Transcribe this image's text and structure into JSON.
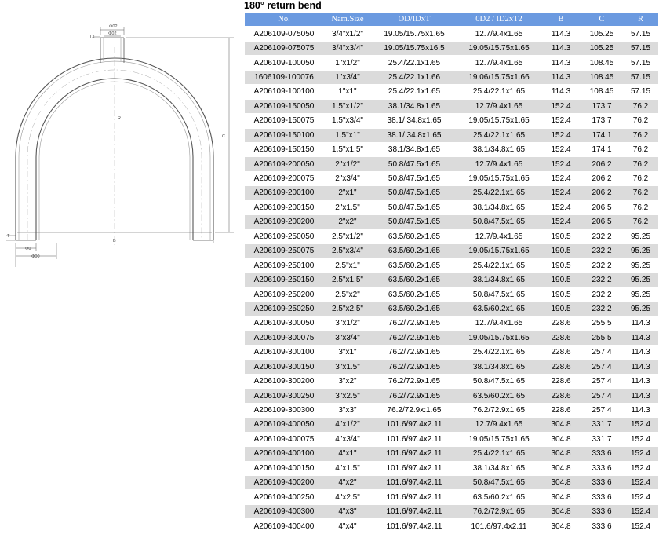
{
  "title": "180° return bend",
  "drawing": {
    "labels": [
      "Φ02",
      "Φ02",
      "T2",
      "C",
      "R",
      "B",
      "T",
      "Φ0",
      "Φ00"
    ]
  },
  "table": {
    "headers": [
      "No.",
      "Nam.Size",
      "OD/IDxT",
      "0D2 / ID2xT2",
      "B",
      "C",
      "R"
    ],
    "rows": [
      [
        "A206109-075050",
        "3/4\"x1/2\"",
        "19.05/15.75x1.65",
        "12.7/9.4x1.65",
        "114.3",
        "105.25",
        "57.15"
      ],
      [
        "A206109-075075",
        "3/4\"x3/4\"",
        "19.05/15.75x16.5",
        "19.05/15.75x1.65",
        "114.3",
        "105.25",
        "57.15"
      ],
      [
        "A206109-100050",
        "1\"x1/2\"",
        "25.4/22.1x1.65",
        "12.7/9.4x1.65",
        "114.3",
        "108.45",
        "57.15"
      ],
      [
        "1606109-100076",
        "1\"x3/4\"",
        "25.4/22.1x1.66",
        "19.06/15.75x1.66",
        "114.3",
        "108.45",
        "57.15"
      ],
      [
        "A206109-100100",
        "1\"x1\"",
        "25.4/22.1x1.65",
        "25.4/22.1x1.65",
        "114.3",
        "108.45",
        "57.15"
      ],
      [
        "A206109-150050",
        "1.5\"x1/2\"",
        "38.1/34.8x1.65",
        "12.7/9.4x1.65",
        "152.4",
        "173.7",
        "76.2"
      ],
      [
        "A206109-150075",
        "1.5\"x3/4\"",
        "38.1/ 34.8x1.65",
        "19.05/15.75x1.65",
        "152.4",
        "173.7",
        "76.2"
      ],
      [
        "A206109-150100",
        "1.5\"x1\"",
        "38.1/ 34.8x1.65",
        "25.4/22.1x1.65",
        "152.4",
        "174.1",
        "76.2"
      ],
      [
        "A206109-150150",
        "1.5\"x1.5\"",
        "38.1/34.8x1.65",
        "38.1/34.8x1.65",
        "152.4",
        "174.1",
        "76.2"
      ],
      [
        "A206109-200050",
        "2\"x1/2\"",
        "50.8/47.5x1.65",
        "12.7/9.4x1.65",
        "152.4",
        "206.2",
        "76.2"
      ],
      [
        "A206109-200075",
        "2\"x3/4\"",
        "50.8/47.5x1.65",
        "19.05/15.75x1.65",
        "152.4",
        "206.2",
        "76.2"
      ],
      [
        "A206109-200100",
        "2\"x1\"",
        "50.8/47.5x1.65",
        "25.4/22.1x1.65",
        "152.4",
        "206.2",
        "76.2"
      ],
      [
        "A206109-200150",
        "2\"x1.5\"",
        "50.8/47.5x1.65",
        "38.1/34.8x1.65",
        "152.4",
        "206.5",
        "76.2"
      ],
      [
        "A206109-200200",
        "2\"x2\"",
        "50.8/47.5x1.65",
        "50.8/47.5x1.65",
        "152.4",
        "206.5",
        "76.2"
      ],
      [
        "A206109-250050",
        "2.5\"x1/2\"",
        "63.5/60.2x1.65",
        "12.7/9.4x1.65",
        "190.5",
        "232.2",
        "95.25"
      ],
      [
        "A206109-250075",
        "2.5\"x3/4\"",
        "63.5/60.2x1.65",
        "19.05/15.75x1.65",
        "190.5",
        "232.2",
        "95.25"
      ],
      [
        "A206109-250100",
        "2.5\"x1\"",
        "63.5/60.2x1.65",
        "25.4/22.1x1.65",
        "190.5",
        "232.2",
        "95.25"
      ],
      [
        "A206109-250150",
        "2.5\"x1.5\"",
        "63.5/60.2x1.65",
        "38.1/34.8x1.65",
        "190.5",
        "232.2",
        "95.25"
      ],
      [
        "A206109-250200",
        "2.5\"x2\"",
        "63.5/60.2x1.65",
        "50.8/47.5x1.65",
        "190.5",
        "232.2",
        "95.25"
      ],
      [
        "A206109-250250",
        "2.5\"x2.5\"",
        "63.5/60.2x1.65",
        "63.5/60.2x1.65",
        "190.5",
        "232.2",
        "95.25"
      ],
      [
        "A206109-300050",
        "3\"x1/2\"",
        "76.2/72.9x1.65",
        "12.7/9.4x1.65",
        "228.6",
        "255.5",
        "114.3"
      ],
      [
        "A206109-300075",
        "3\"x3/4\"",
        "76.2/72.9x1.65",
        "19.05/15.75x1.65",
        "228.6",
        "255.5",
        "114.3"
      ],
      [
        "A206109-300100",
        "3\"x1\"",
        "76.2/72.9x1.65",
        "25.4/22.1x1.65",
        "228.6",
        "257.4",
        "114.3"
      ],
      [
        "A206109-300150",
        "3\"x1.5\"",
        "76.2/72.9x1.65",
        "38.1/34.8x1.65",
        "228.6",
        "257.4",
        "114.3"
      ],
      [
        "A206109-300200",
        "3\"x2\"",
        "76.2/72.9x1.65",
        "50.8/47.5x1.65",
        "228.6",
        "257.4",
        "114.3"
      ],
      [
        "A206109-300250",
        "3\"x2.5\"",
        "76.2/72.9x1.65",
        "63.5/60.2x1.65",
        "228.6",
        "257.4",
        "114.3"
      ],
      [
        "A206109-300300",
        "3\"x3\"",
        "76.2/72.9x:1.65",
        "76.2/72.9x1.65",
        "228.6",
        "257.4",
        "114.3"
      ],
      [
        "A206109-400050",
        "4\"x1/2\"",
        "101.6/97.4x2.11",
        "12.7/9.4x1.65",
        "304.8",
        "331.7",
        "152.4"
      ],
      [
        "A206109-400075",
        "4\"x3/4\"",
        "101.6/97.4x2.11",
        "19.05/15.75x1.65",
        "304.8",
        "331.7",
        "152.4"
      ],
      [
        "A206109-400100",
        "4\"x1\"",
        "101.6/97.4x2.11",
        "25.4/22.1x1.65",
        "304.8",
        "333.6",
        "152.4"
      ],
      [
        "A206109-400150",
        "4\"x1.5\"",
        "101.6/97.4x2.11",
        "38.1/34.8x1.65",
        "304.8",
        "333.6",
        "152.4"
      ],
      [
        "A206109-400200",
        "4\"x2\"",
        "101.6/97.4x2.11",
        "50.8/47.5x1.65",
        "304.8",
        "333.6",
        "152.4"
      ],
      [
        "A206109-400250",
        "4\"x2.5\"",
        "101.6/97.4x2.11",
        "63.5/60.2x1.65",
        "304.8",
        "333.6",
        "152.4"
      ],
      [
        "A206109-400300",
        "4\"x3\"",
        "101.6/97.4x2.11",
        "76.2/72.9x1.65",
        "304.8",
        "333.6",
        "152.4"
      ],
      [
        "A206109-400400",
        "4\"x4\"",
        "101.6/97.4x2.11",
        "101.6/97.4x2.11",
        "304.8",
        "333.6",
        "152.4"
      ]
    ]
  }
}
